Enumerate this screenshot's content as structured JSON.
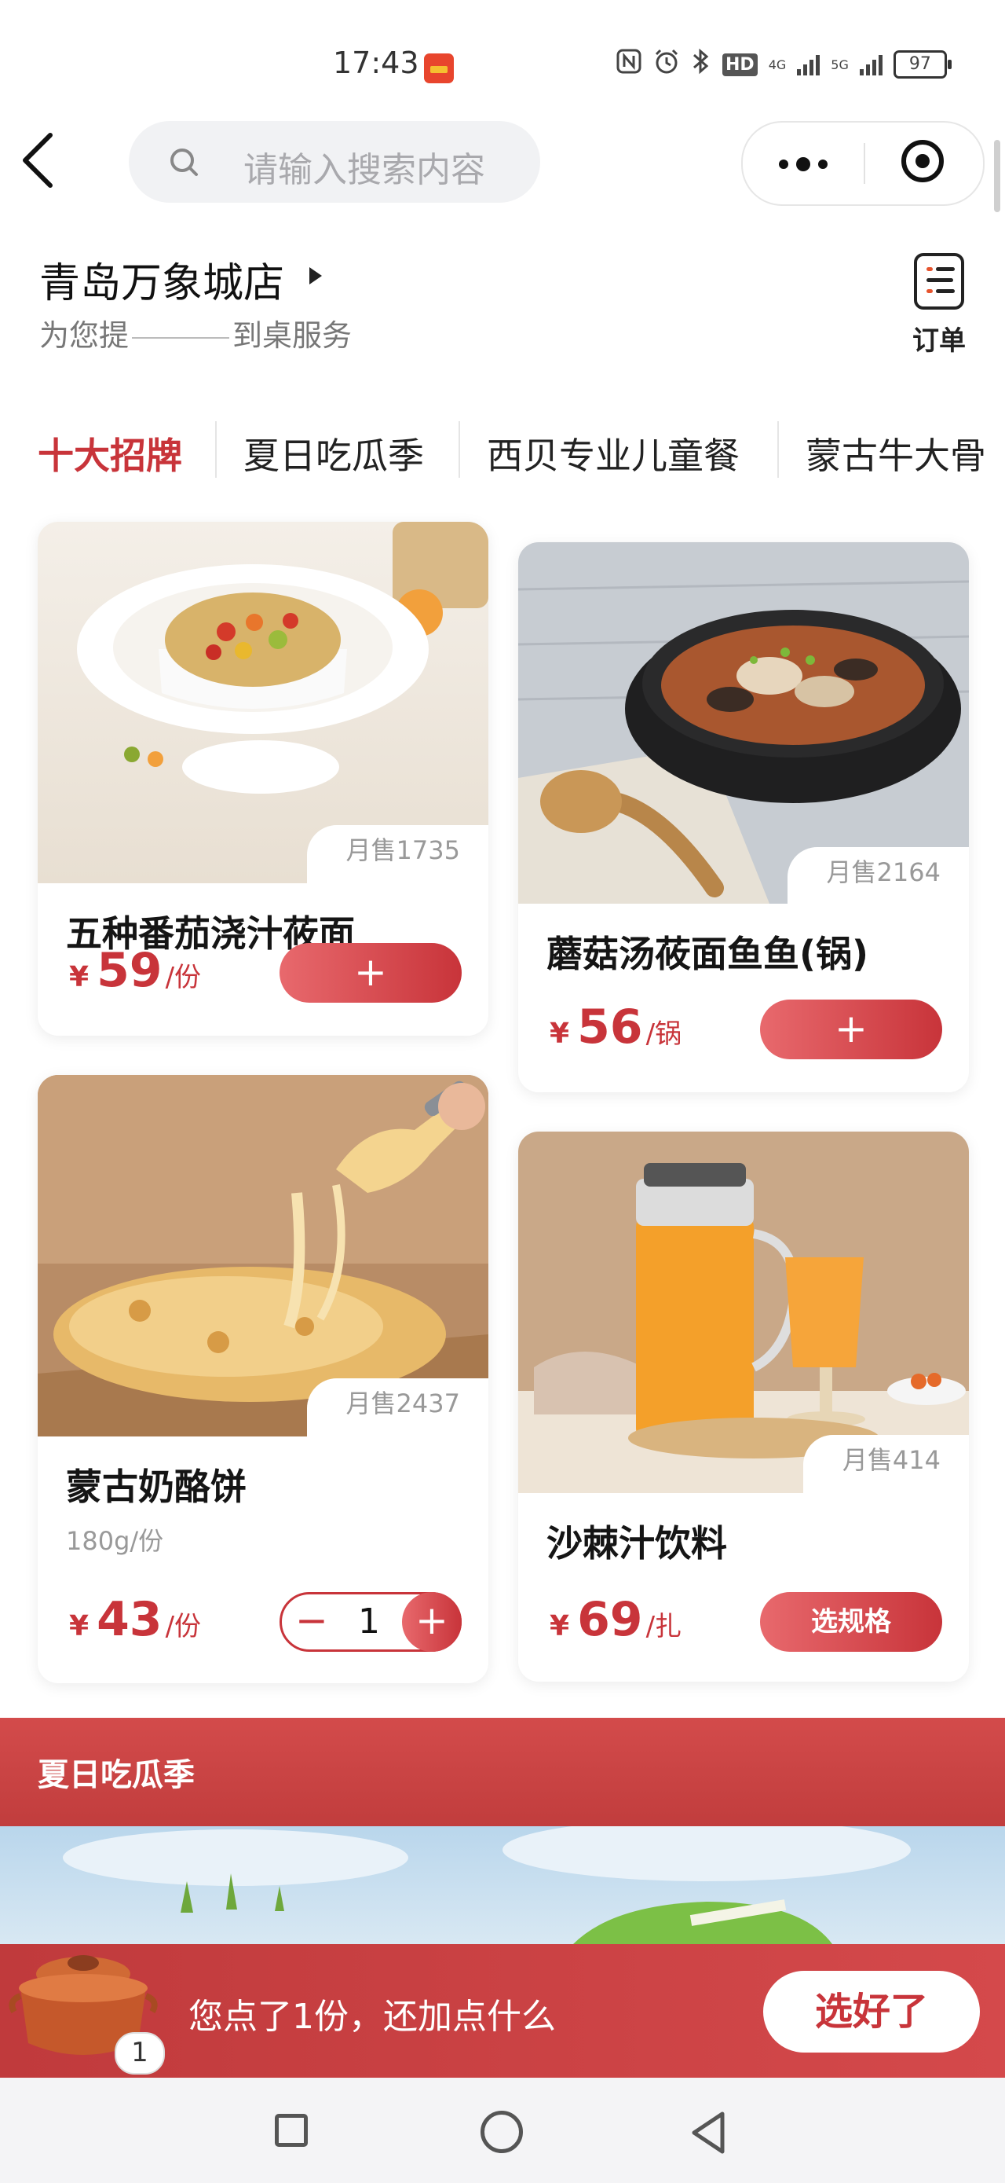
{
  "status_bar": {
    "time": "17:43",
    "battery": "97",
    "network_1": "4G",
    "network_2": "5G",
    "hd": "HD",
    "icons": [
      "nfc-icon",
      "alarm-icon",
      "bluetooth-icon",
      "hd-icon",
      "signal-icon",
      "signal-icon",
      "battery-icon"
    ]
  },
  "nav": {
    "search_placeholder": "请输入搜索内容"
  },
  "store": {
    "name": "青岛万象城店",
    "subtitle_start": "为您提",
    "subtitle_end": "到桌服务",
    "order_label": "订单"
  },
  "tabs": [
    {
      "label": "十大招牌",
      "active": true
    },
    {
      "label": "夏日吃瓜季",
      "active": false
    },
    {
      "label": "西贝专业儿童餐",
      "active": false
    },
    {
      "label": "蒙古牛大骨",
      "active": false
    }
  ],
  "products": [
    {
      "name": "五种番茄浇汁莜面",
      "sales": "月售1735",
      "currency": "¥",
      "price": "59",
      "unit": "/份",
      "action": "+"
    },
    {
      "name": "蘑菇汤莜面鱼鱼(锅)",
      "sales": "月售2164",
      "currency": "¥",
      "price": "56",
      "unit": "/锅",
      "action": "+"
    },
    {
      "name": "蒙古奶酪饼",
      "spec": "180g/份",
      "sales": "月售2437",
      "currency": "¥",
      "price": "43",
      "unit": "/份",
      "quantity": "1",
      "minus": "−",
      "plus": "+"
    },
    {
      "name": "沙棘汁饮料",
      "sales": "月售414",
      "currency": "¥",
      "price": "69",
      "unit": "/扎",
      "action": "选规格"
    }
  ],
  "section": {
    "title": "夏日吃瓜季"
  },
  "cart": {
    "badge": "1",
    "text": "您点了1份，还加点什么",
    "done_label": "选好了"
  },
  "colors": {
    "accent": "#c8343a",
    "accent_light": "#e8696d"
  }
}
